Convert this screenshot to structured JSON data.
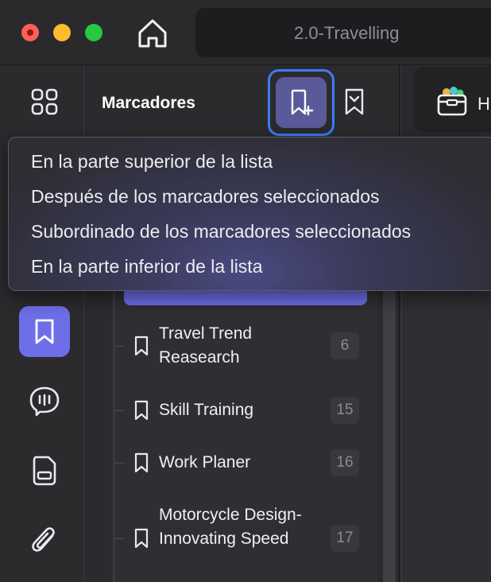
{
  "window": {
    "title": "2.0-Travelling"
  },
  "sidebar": {
    "title": "Marcadores",
    "items": [
      {
        "label": "Travel Trend Reasearch",
        "count": "6"
      },
      {
        "label": "Skill Training",
        "count": "15"
      },
      {
        "label": "Work Planer",
        "count": "16"
      },
      {
        "label": "Motorcycle Design-Innovating Speed",
        "count": "17"
      }
    ]
  },
  "dropdown": {
    "options": [
      "En la parte superior de la lista",
      "Después de los marcadores seleccionados",
      "Subordinado de los marcadores seleccionados",
      "En la parte inferior de la lista"
    ]
  },
  "right_tab": {
    "label": "H"
  },
  "icons": {
    "home": "home-icon",
    "grid": "grid-icon",
    "bookmark": "bookmark-icon",
    "comment": "comment-icon",
    "document": "document-icon",
    "attachment": "paperclip-icon",
    "add_bookmark": "bookmark-plus-icon",
    "collapse": "bookmark-collapse-icon"
  },
  "colors": {
    "accent": "#6e6ee8",
    "focus_ring": "#3d7bf6"
  }
}
